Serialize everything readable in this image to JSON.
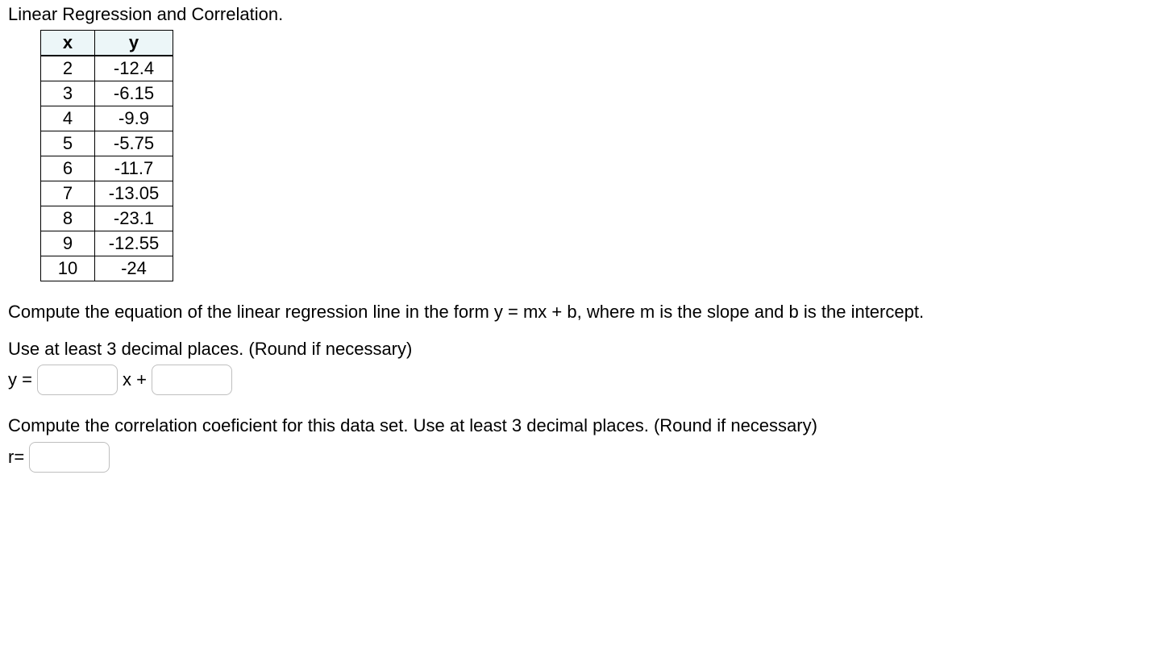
{
  "title": "Linear Regression and Correlation.",
  "table": {
    "headers": {
      "x": "x",
      "y": "y"
    },
    "rows": [
      {
        "x": "2",
        "y": "-12.4"
      },
      {
        "x": "3",
        "y": "-6.15"
      },
      {
        "x": "4",
        "y": "-9.9"
      },
      {
        "x": "5",
        "y": "-5.75"
      },
      {
        "x": "6",
        "y": "-11.7"
      },
      {
        "x": "7",
        "y": "-13.05"
      },
      {
        "x": "8",
        "y": "-23.1"
      },
      {
        "x": "9",
        "y": "-12.55"
      },
      {
        "x": "10",
        "y": "-24"
      }
    ]
  },
  "instructions": {
    "p1": "Compute the equation of the linear regression line in the form y = mx + b, where m is the slope and b is the intercept.",
    "p2": "Use at least 3 decimal places. (Round if necessary)",
    "p3": "Compute the correlation coeficient for this data set. Use at least 3 decimal places. (Round if necessary)"
  },
  "equation": {
    "y_prefix": "y =",
    "x_mid": "x +",
    "r_prefix": "r="
  },
  "inputs": {
    "slope": "",
    "intercept": "",
    "r": ""
  }
}
